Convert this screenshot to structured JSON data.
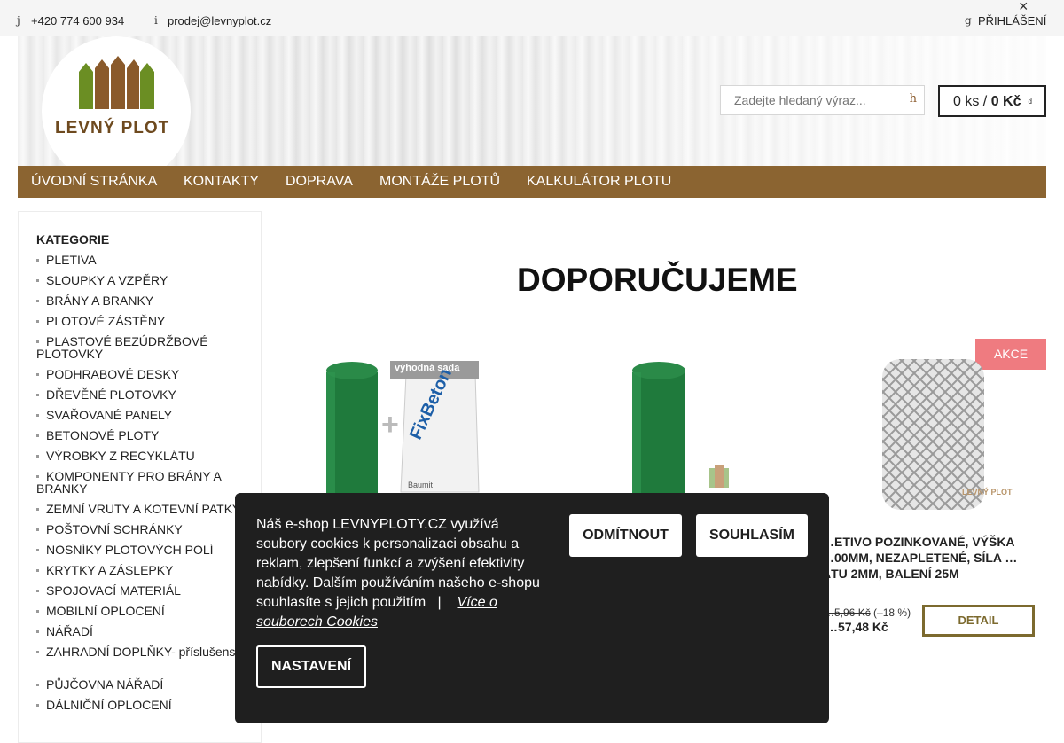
{
  "topbar": {
    "phone_icon": "j",
    "phone": "+420 774 600 934",
    "mail_icon": "i",
    "email": "prodej@levnyplot.cz",
    "login_icon": "g",
    "login": "PŘIHLÁŠENÍ",
    "close": "×"
  },
  "header": {
    "logo_text": "LEVNÝ PLOT",
    "search_placeholder": "Zadejte hledaný výraz...",
    "search_icon": "h",
    "cart_qty": "0 ks /",
    "cart_price": "0 Kč",
    "cart_caret": "d"
  },
  "nav": {
    "items": [
      "ÚVODNÍ STRÁNKA",
      "KONTAKTY",
      "DOPRAVA",
      "MONTÁŽE PLOTŮ",
      "KALKULÁTOR PLOTU"
    ]
  },
  "sidebar": {
    "heading": "KATEGORIE",
    "categories": [
      "PLETIVA",
      "SLOUPKY A VZPĚRY",
      "BRÁNY A BRANKY",
      "PLOTOVÉ ZÁSTĚNY",
      "PLASTOVÉ BEZÚDRŽBOVÉ PLOTOVKY",
      "PODHRABOVÉ DESKY",
      "DŘEVĚNÉ PLOTOVKY",
      "SVAŘOVANÉ PANELY",
      "BETONOVÉ PLOTY",
      "VÝROBKY Z RECYKLÁTU",
      "KOMPONENTY PRO BRÁNY A BRANKY",
      "ZEMNÍ VRUTY A KOTEVNÍ PATKY",
      "POŠTOVNÍ SCHRÁNKY",
      "NOSNÍKY PLOTOVÝCH POLÍ",
      "KRYTKY A ZÁSLEPKY",
      "SPOJOVACÍ MATERIÁL",
      "MOBILNÍ OPLOCENÍ",
      "NÁŘADÍ",
      "ZAHRADNÍ DOPLŇKY- příslušenství",
      "PŮJČOVNA NÁŘADÍ",
      "DÁLNIČNÍ OPLOCENÍ"
    ]
  },
  "main": {
    "title": "DOPORUČUJEME",
    "products": [
      {
        "badge": "výhodná sada",
        "brand": "FixBeton",
        "maker": "Baumit"
      },
      {},
      {
        "akce": "AKCE",
        "name": "…ETIVO POZINKOVANÉ, VÝŠKA …00MM, NEZAPLETENÉ, SÍLA …ÁTU 2MM, BALENÍ 25M",
        "old_price": "…5,96 Kč",
        "discount": "(–18 %)",
        "price": "…57,48 Kč",
        "detail": "DETAIL",
        "watermark": "LEVNÝ PLOT"
      }
    ]
  },
  "cookie": {
    "text": "Náš e-shop LEVNYPLOTY.CZ využívá soubory cookies k personalizaci obsahu a reklam, zlepšení funkcí a zvýšení efektivity nabídky. Dalším používáním našeho e-shopu souhlasíte s jejich použitím",
    "separator": "|",
    "link": "Více o souborech Cookies",
    "decline": "ODMÍTNOUT",
    "accept": "SOUHLASÍM",
    "settings": "NASTAVENÍ"
  },
  "colors": {
    "nav_bg": "#8b6431",
    "akce_bg": "#ef7b80",
    "detail_border": "#7c6a2f",
    "cookie_bg": "#1f1f1f"
  }
}
